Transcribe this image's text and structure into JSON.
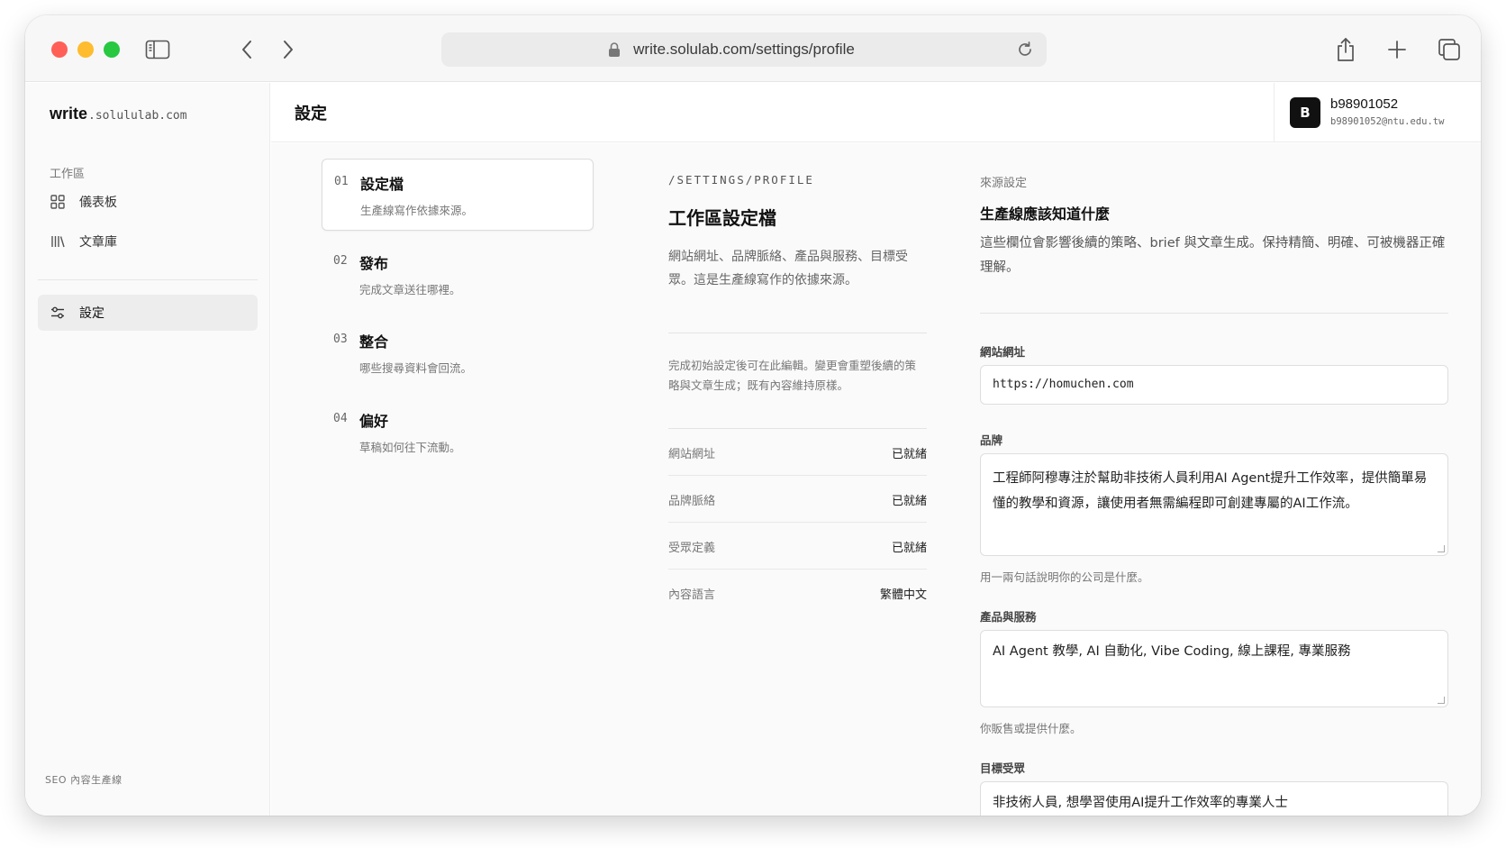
{
  "browser": {
    "url": "write.solulab.com/settings/profile"
  },
  "sidebar": {
    "brand_main": "write",
    "brand_sub": ".solululab.com",
    "section_label": "工作區",
    "items": [
      {
        "label": "儀表板",
        "icon": "grid-icon"
      },
      {
        "label": "文章庫",
        "icon": "library-icon"
      },
      {
        "label": "設定",
        "icon": "sliders-icon",
        "active": true
      }
    ],
    "footer": "SEO 內容生產線"
  },
  "header": {
    "title": "設定",
    "user": {
      "initial": "B",
      "name": "b98901052",
      "email": "b98901052@ntu.edu.tw"
    }
  },
  "steps": [
    {
      "num": "01",
      "title": "設定檔",
      "desc": "生產線寫作依據來源。",
      "active": true
    },
    {
      "num": "02",
      "title": "發布",
      "desc": "完成文章送往哪裡。"
    },
    {
      "num": "03",
      "title": "整合",
      "desc": "哪些搜尋資料會回流。"
    },
    {
      "num": "04",
      "title": "偏好",
      "desc": "草稿如何往下流動。"
    }
  ],
  "overview": {
    "path": "/SETTINGS/PROFILE",
    "title": "工作區設定檔",
    "desc": "網站網址、品牌脈絡、產品與服務、目標受眾。這是生產線寫作的依據來源。",
    "note": "完成初始設定後可在此編輯。變更會重塑後續的策略與文章生成；既有內容維持原樣。",
    "status": [
      {
        "label": "網站網址",
        "value": "已就緒"
      },
      {
        "label": "品牌脈絡",
        "value": "已就緒"
      },
      {
        "label": "受眾定義",
        "value": "已就緒"
      },
      {
        "label": "內容語言",
        "value": "繁體中文"
      }
    ]
  },
  "form": {
    "kicker": "來源設定",
    "title": "生產線應該知道什麼",
    "desc": "這些欄位會影響後續的策略、brief 與文章生成。保持精簡、明確、可被機器正確理解。",
    "website": {
      "label": "網站網址",
      "value": "https://homuchen.com"
    },
    "brand": {
      "label": "品牌",
      "value": "工程師阿穆專注於幫助非技術人員利用AI Agent提升工作效率，提供簡單易懂的教學和資源，讓使用者無需編程即可創建專屬的AI工作流。",
      "help": "用一兩句話說明你的公司是什麼。"
    },
    "products": {
      "label": "產品與服務",
      "value": "AI Agent 教學, AI 自動化, Vibe Coding, 線上課程, 專業服務",
      "help": "你販售或提供什麼。"
    },
    "audience": {
      "label": "目標受眾",
      "value": "非技術人員, 想學習使用AI提升工作效率的專業人士"
    }
  }
}
